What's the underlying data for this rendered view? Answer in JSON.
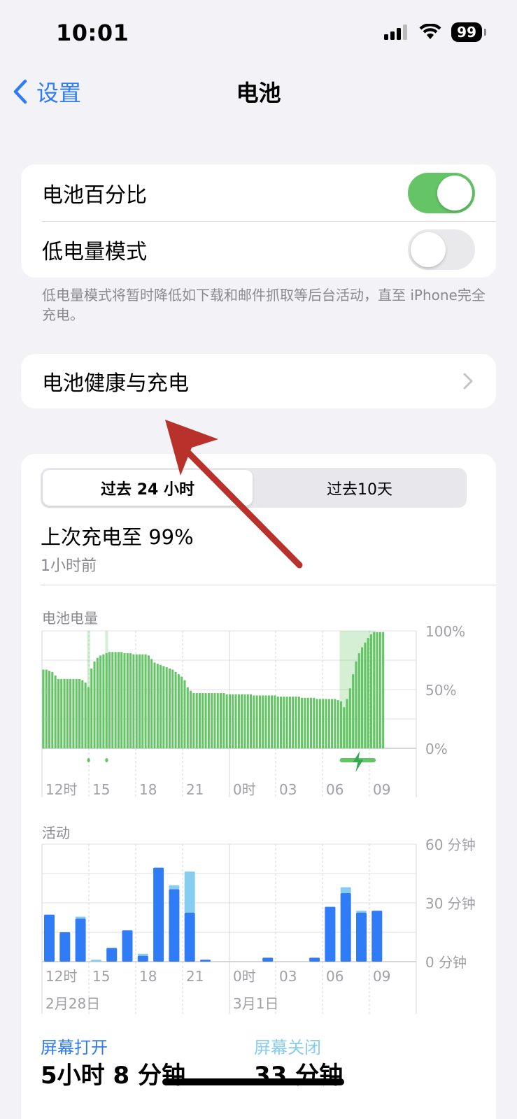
{
  "status": {
    "time": "10:01",
    "battery": "99"
  },
  "nav": {
    "back_label": "设置",
    "title": "电池"
  },
  "settings": {
    "battery_percentage": {
      "label": "电池百分比",
      "on": true
    },
    "low_power_mode": {
      "label": "低电量模式",
      "on": false
    },
    "footnote": "低电量模式将暂时降低如下载和邮件抓取等后台活动，直至 iPhone完全充电。"
  },
  "health": {
    "label": "电池健康与充电"
  },
  "usage_card": {
    "tabs": [
      "过去 24 小时",
      "过去10天"
    ],
    "active_tab": 0,
    "last_charge": "上次充电至 99%",
    "last_charge_ago": "1小时前",
    "screen_on_label": "屏幕打开",
    "screen_on_value": "5小时 8 分钟",
    "screen_off_label": "屏幕关闭",
    "screen_off_value": "33 分钟"
  },
  "colors": {
    "accent": "#2f7cf6",
    "battery_green": "#65c466",
    "screen_on": "#2f7cf6",
    "screen_off": "#86cdf0",
    "annotation_arrow": "#b8322b"
  },
  "chart_data": [
    {
      "type": "bar",
      "title": "电池电量",
      "x_ticks": [
        "12时",
        "15",
        "18",
        "21",
        "0时",
        "03",
        "06",
        "09"
      ],
      "y_ticks": [
        "100%",
        "50%",
        "0%"
      ],
      "ylim": [
        0,
        100
      ],
      "charging_spans": [
        [
          15,
          16
        ],
        [
          21,
          22
        ],
        [
          99,
          111
        ]
      ],
      "values": [
        67,
        67,
        66,
        65,
        62,
        59,
        59,
        59,
        59,
        59,
        59,
        59,
        59,
        58,
        56,
        52,
        68,
        74,
        77,
        79,
        80,
        81,
        82,
        82,
        82,
        82,
        82,
        81,
        81,
        81,
        80,
        80,
        80,
        80,
        80,
        79,
        76,
        73,
        72,
        71,
        70,
        69,
        68,
        67,
        65,
        63,
        61,
        58,
        52,
        49,
        47,
        47,
        47,
        47,
        47,
        47,
        47,
        47,
        47,
        47,
        47,
        46,
        46,
        46,
        46,
        46,
        46,
        46,
        46,
        46,
        45,
        45,
        45,
        45,
        45,
        45,
        45,
        45,
        44,
        44,
        44,
        44,
        44,
        44,
        44,
        44,
        43,
        43,
        43,
        43,
        43,
        42,
        42,
        42,
        42,
        42,
        42,
        42,
        41,
        40,
        35,
        42,
        51,
        63,
        74,
        81,
        86,
        90,
        94,
        97,
        99,
        99,
        99,
        99
      ]
    },
    {
      "type": "bar",
      "title": "活动",
      "x_ticks": [
        "12时",
        "15",
        "18",
        "21",
        "0时",
        "03",
        "06",
        "09"
      ],
      "date_labels": [
        "2月28日",
        "3月1日"
      ],
      "y_ticks": [
        "60 分钟",
        "30 分钟",
        "0 分钟"
      ],
      "ylim": [
        0,
        60
      ],
      "series": [
        {
          "name": "屏幕打开",
          "values": [
            24,
            15,
            22,
            0,
            7,
            16,
            3,
            48,
            37,
            25,
            1,
            0,
            0,
            0,
            2,
            0,
            0,
            2,
            28,
            35,
            25,
            26
          ]
        },
        {
          "name": "屏幕关闭",
          "values": [
            0,
            0,
            1,
            1,
            0,
            0,
            1,
            0,
            2,
            21,
            0,
            0,
            0,
            0,
            0,
            0,
            0,
            0,
            0,
            3,
            1,
            0
          ]
        }
      ]
    }
  ]
}
